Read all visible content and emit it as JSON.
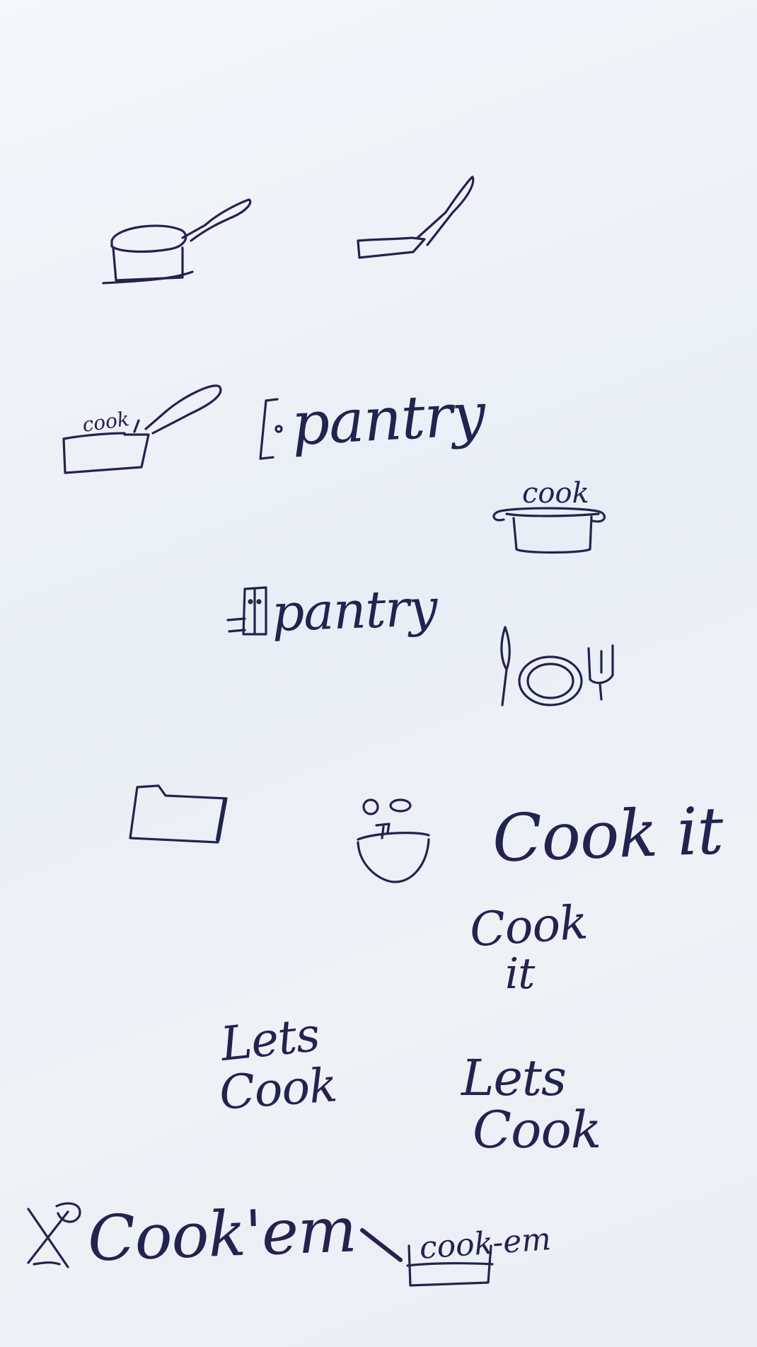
{
  "ink_color": "#23234f",
  "paper_color": "#eef2f7",
  "sketches": {
    "pan_cook_label": "cook",
    "pot_cook_label": "cook",
    "pantry_1": "pantry",
    "pantry_2": "pantry",
    "cook_it_1": "Cook it",
    "cook_it_2_line1": "Cook",
    "cook_it_2_line2": "it",
    "lets_cook_1_line1": "Lets",
    "lets_cook_1_line2": "Cook",
    "lets_cook_2_line1": "Lets",
    "lets_cook_2_line2": "Cook",
    "cook_em_1": "Cook'em",
    "cook_em_2": "cook-em"
  },
  "icons": [
    "pan-with-lid-icon",
    "frying-pan-icon",
    "pan-with-label-icon",
    "pantry-door-icon",
    "cooking-pot-icon",
    "pantry-cabinet-icon",
    "knife-plate-fork-icon",
    "folder-icon",
    "mixing-bowl-icon",
    "crossed-utensils-icon",
    "pan-with-knife-icon"
  ]
}
